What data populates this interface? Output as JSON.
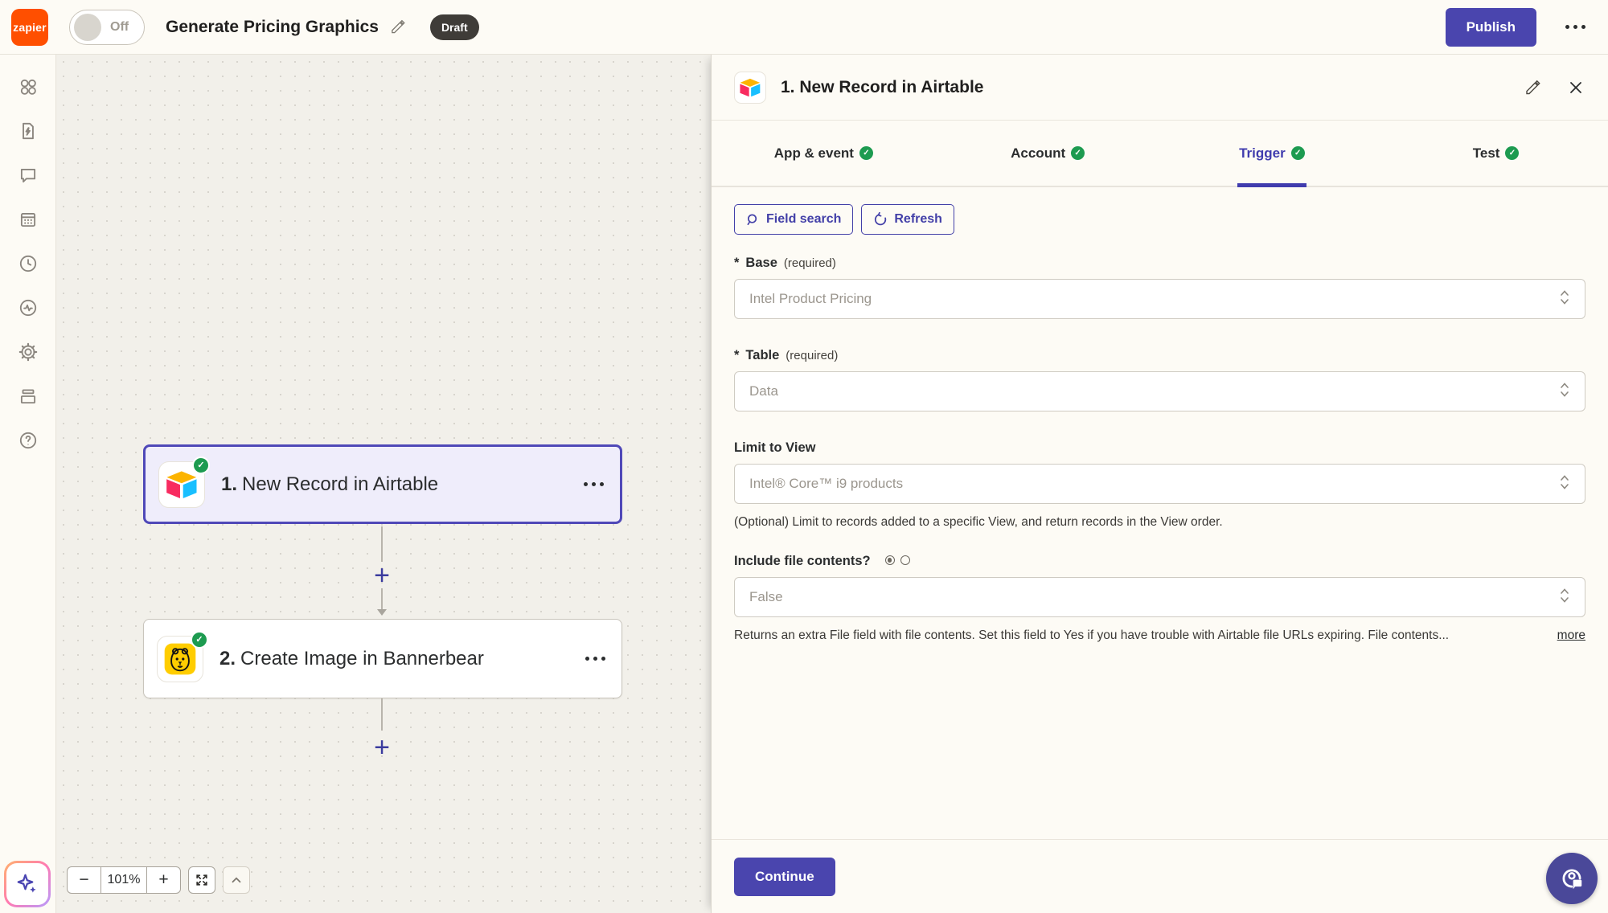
{
  "topbar": {
    "logo_text": "zapier",
    "toggle_label": "Off",
    "title": "Generate Pricing Graphics",
    "status_badge": "Draft",
    "publish_label": "Publish"
  },
  "sidebar": {
    "icons": [
      "apps",
      "zap-file",
      "chat",
      "calendar",
      "history",
      "monitoring",
      "settings",
      "tables",
      "help"
    ]
  },
  "canvas": {
    "zoom_level": "101%",
    "steps": [
      {
        "number": "1.",
        "title": "New Record in Airtable",
        "app": "Airtable"
      },
      {
        "number": "2.",
        "title": "Create Image in Bannerbear",
        "app": "Bannerbear"
      }
    ]
  },
  "panel": {
    "step_title": "1. New Record in Airtable",
    "tabs": [
      {
        "label": "App & event"
      },
      {
        "label": "Account"
      },
      {
        "label": "Trigger"
      },
      {
        "label": "Test"
      }
    ],
    "active_tab": "Trigger",
    "toolbar": {
      "field_search_label": "Field search",
      "refresh_label": "Refresh"
    },
    "fields": {
      "base": {
        "required_mark": "*",
        "label": "Base",
        "required_note": "(required)",
        "value": "Intel Product Pricing"
      },
      "table": {
        "required_mark": "*",
        "label": "Table",
        "required_note": "(required)",
        "value": "Data"
      },
      "limit_to_view": {
        "label": "Limit to View",
        "value": "Intel® Core™ i9 products",
        "helper": "(Optional) Limit to records added to a specific View, and return records in the View order."
      },
      "include_file_contents": {
        "label": "Include file contents?",
        "value": "False",
        "helper": "Returns an extra File field with file contents. Set this field to Yes if you have trouble with Airtable file URLs expiring. File contents...",
        "more_label": "more"
      }
    },
    "footer": {
      "continue_label": "Continue"
    }
  },
  "colors": {
    "brand_orange": "#ff4f00",
    "primary_indigo": "#4a45ae",
    "success_green": "#1d9b50",
    "draft_badge_bg": "#3f3c38"
  }
}
